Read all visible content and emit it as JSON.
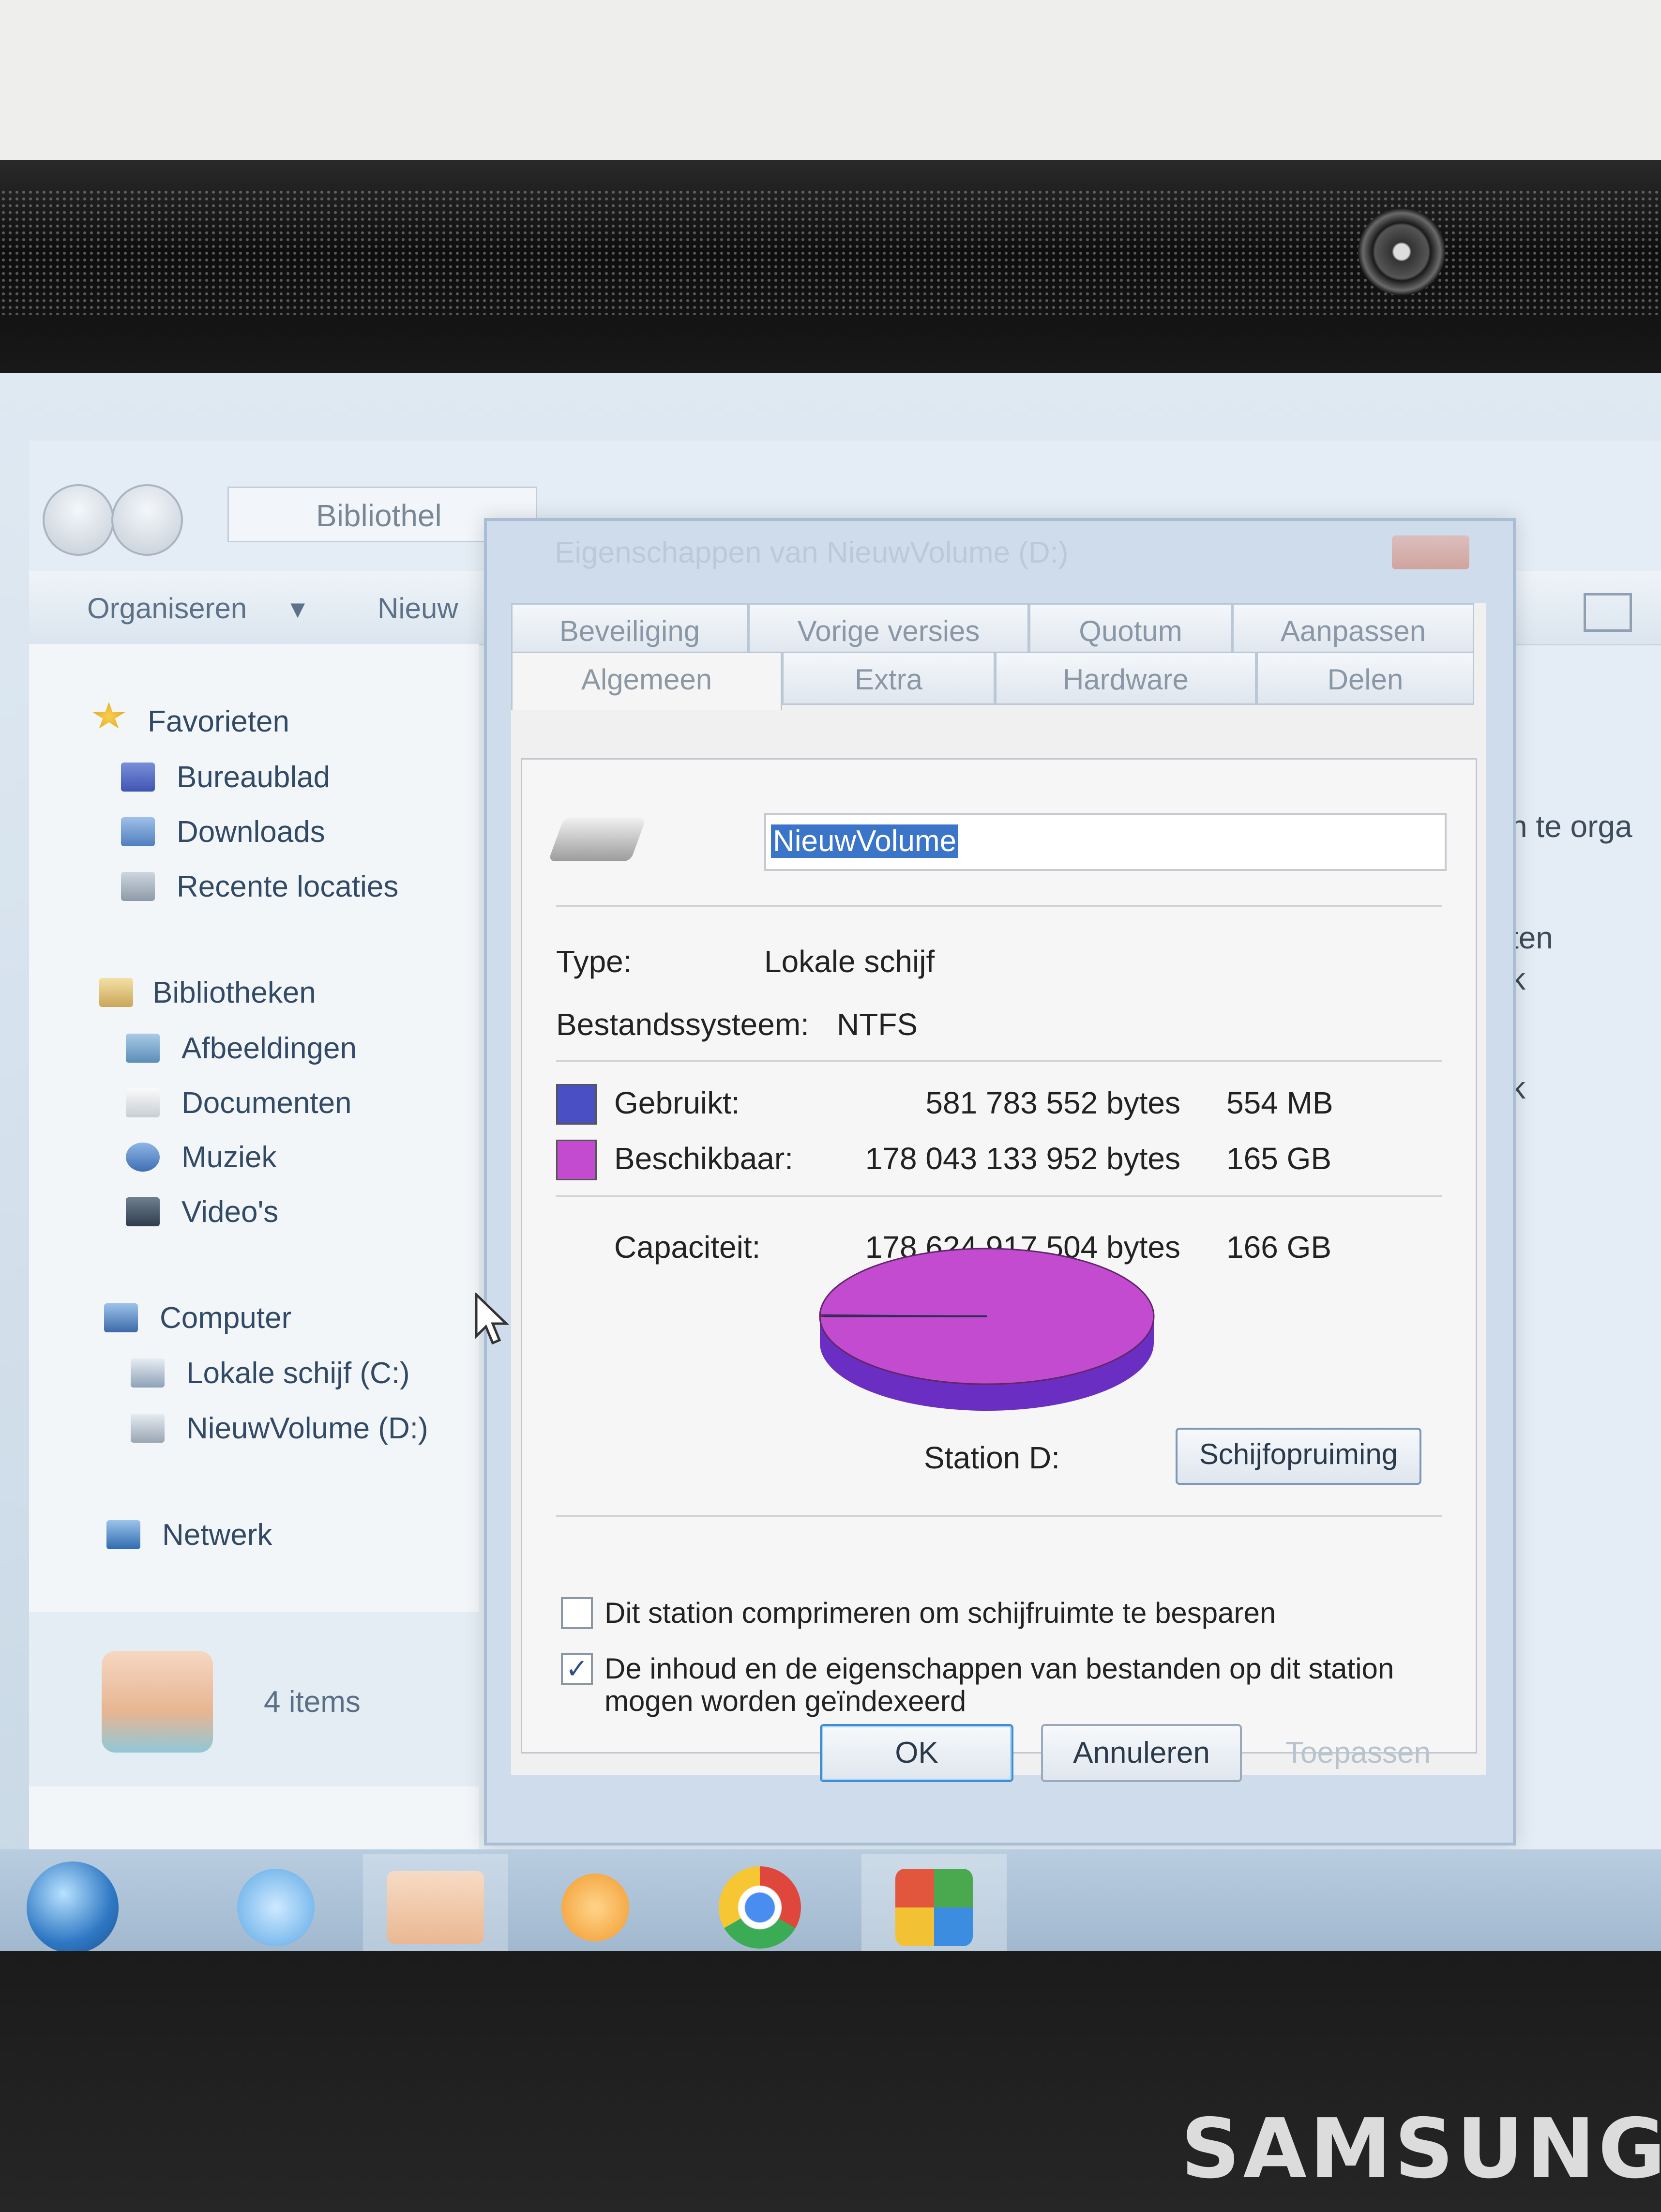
{
  "device": {
    "brand": "SAMSUNG"
  },
  "explorer": {
    "address": "Bibliothel",
    "toolbar": {
      "organize": "Organiseren",
      "new_folder": "Nieuw"
    },
    "nav": {
      "favorites": {
        "label": "Favorieten",
        "items": [
          "Bureaublad",
          "Downloads",
          "Recente locaties"
        ]
      },
      "libraries": {
        "label": "Bibliotheken",
        "items": [
          "Afbeeldingen",
          "Documenten",
          "Muziek",
          "Video's"
        ]
      },
      "computer": {
        "label": "Computer",
        "items": [
          "Lokale schijf (C:)",
          "NieuwVolume (D:)"
        ]
      },
      "network": {
        "label": "Netwerk"
      }
    },
    "details": {
      "count": "4 items"
    },
    "right_fragments": [
      "n te orga",
      "ten",
      "k",
      "k"
    ]
  },
  "dialog": {
    "title": "Eigenschappen van NieuwVolume (D:)",
    "tabs_back": [
      "Beveiliging",
      "Vorige versies",
      "Quotum",
      "Aanpassen"
    ],
    "tabs_front": [
      "Algemeen",
      "Extra",
      "Hardware",
      "Delen"
    ],
    "volume_name": "NieuwVolume",
    "type_label": "Type:",
    "type_value": "Lokale schijf",
    "fs_label": "Bestandssysteem:",
    "fs_value": "NTFS",
    "used_label": "Gebruikt:",
    "used_bytes": "581 783 552 bytes",
    "used_size": "554 MB",
    "free_label": "Beschikbaar:",
    "free_bytes": "178 043 133 952 bytes",
    "free_size": "165 GB",
    "capacity_label": "Capaciteit:",
    "capacity_bytes": "178 624 917 504 bytes",
    "capacity_size": "166 GB",
    "drive_label": "Station D:",
    "cleanup_button": "Schijfopruiming",
    "compress_label": "Dit station comprimeren om schijfruimte te besparen",
    "compress_checked": false,
    "index_label_1": "De inhoud en de eigenschappen van bestanden op dit station",
    "index_label_2": "mogen worden geïndexeerd",
    "index_checked": true,
    "ok": "OK",
    "cancel": "Annuleren",
    "apply": "Toepassen",
    "colors": {
      "used": "#4a4fc4",
      "free": "#c24bd0"
    }
  },
  "taskbar": {
    "icons": [
      "start-orb",
      "ie-icon",
      "folder-icon",
      "media-player-icon",
      "chrome-icon",
      "windows-flag-icon"
    ]
  },
  "chart_data": {
    "type": "pie",
    "categories": [
      "Gebruikt",
      "Beschikbaar"
    ],
    "values": [
      581783552,
      178043133952
    ],
    "colors": [
      "#4a4fc4",
      "#c24bd0"
    ]
  }
}
